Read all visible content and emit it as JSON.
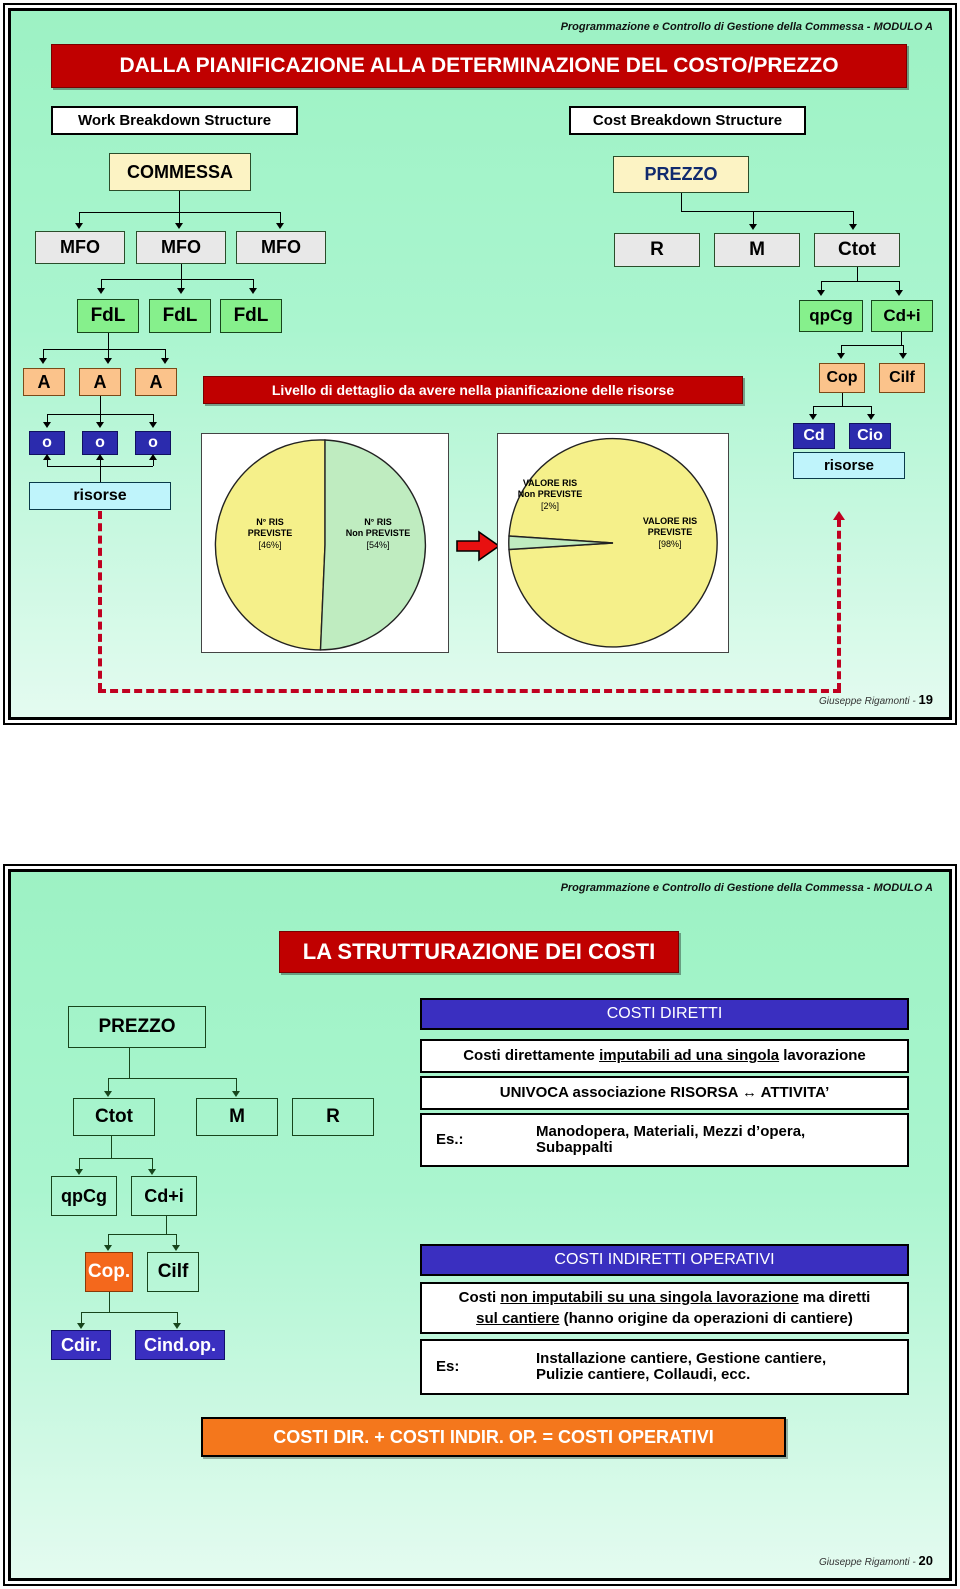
{
  "slide1": {
    "header": "Programmazione e Controllo di Gestione della Commessa - MODULO A",
    "title": "DALLA PIANIFICAZIONE ALLA DETERMINAZIONE DEL COSTO/PREZZO",
    "wbs_label": "Work Breakdown Structure",
    "cbs_label": "Cost Breakdown Structure",
    "banner": "Livello di dettaglio da avere nella pianificazione delle risorse",
    "wbs": {
      "root": "COMMESSA",
      "level2": [
        "MFO",
        "MFO",
        "MFO"
      ],
      "level3": [
        "FdL",
        "FdL",
        "FdL"
      ],
      "level4": [
        "A",
        "A",
        "A"
      ],
      "level5": [
        "o",
        "o",
        "o"
      ],
      "resources": "risorse"
    },
    "cbs": {
      "root": "PREZZO",
      "level2": [
        "R",
        "M",
        "Ctot"
      ],
      "level3": [
        "qpCg",
        "Cd+i"
      ],
      "level4": [
        "Cop",
        "Cilf"
      ],
      "level5": [
        "Cd",
        "Cio"
      ],
      "resources": "risorse"
    },
    "footer_author": "Giuseppe Rigamonti - ",
    "footer_page": "19"
  },
  "chart_data": [
    {
      "type": "pie",
      "title": "N° RIS",
      "labels": [
        "N° RIS PREVISTE",
        "N° RIS Non PREVISTE"
      ],
      "label_lines": [
        [
          "N° RIS",
          "PREVISTE",
          "[46%]"
        ],
        [
          "N° RIS",
          "Non PREVISTE",
          "[54%]"
        ]
      ],
      "values": [
        46,
        54
      ],
      "pct_labels": [
        "[46%]",
        "[54%]"
      ],
      "colors": [
        "#f5f08a",
        "#bfecc0"
      ],
      "legend": "none"
    },
    {
      "type": "pie",
      "title": "VALORE RIS",
      "labels": [
        "VALORE RIS Non PREVISTE",
        "VALORE RIS PREVISTE"
      ],
      "label_lines": [
        [
          "VALORE RIS",
          "Non PREVISTE",
          "[2%]"
        ],
        [
          "VALORE RIS",
          "PREVISTE",
          "[98%]"
        ]
      ],
      "values": [
        2,
        98
      ],
      "pct_labels": [
        "[2%]",
        "[98%]"
      ],
      "colors": [
        "#bfecc0",
        "#f5f08a"
      ],
      "legend": "none"
    }
  ],
  "slide2": {
    "header": "Programmazione e Controllo di Gestione della Commessa - MODULO A",
    "title": "LA STRUTTURAZIONE DEI COSTI",
    "tree": {
      "root": "PREZZO",
      "level2": [
        "Ctot",
        "M",
        "R"
      ],
      "level3": [
        "qpCg",
        "Cd+i"
      ],
      "level4": [
        "Cop.",
        "Cilf"
      ],
      "level5": [
        "Cdir.",
        "Cind.op."
      ]
    },
    "direct": {
      "heading": "COSTI DIRETTI",
      "definition_pre": "Costi direttamente ",
      "definition_underline": "imputabili ad una singola",
      "definition_post": " lavorazione",
      "association": "UNIVOCA associazione RISORSA ↔ ATTIVITA’",
      "example_key": "Es.:",
      "example_lines": [
        "Manodopera, Materiali, Mezzi d’opera,",
        "Subappalti"
      ]
    },
    "indirect": {
      "heading": "COSTI INDIRETTI OPERATIVI",
      "definition_l1_pre": "Costi ",
      "definition_l1_underline": "non imputabili su una singola lavorazione",
      "definition_l1_post": " ma diretti",
      "definition_l2_underline": "sul cantiere",
      "definition_l2_post": " (hanno origine da operazioni di cantiere)",
      "example_key": "Es:",
      "example_lines": [
        "Installazione cantiere, Gestione cantiere,",
        "Pulizie cantiere, Collaudi, ecc."
      ]
    },
    "sum_bar": "COSTI DIR. + COSTI INDIR. OP. = COSTI OPERATIVI",
    "footer_author": "Giuseppe Rigamonti - ",
    "footer_page": "20"
  },
  "colors": {
    "slide_bg": "#9df2c4",
    "title_red": "#c00000",
    "bar_blue": "#3a2fc0",
    "bar_orange": "#f4771c",
    "accent_navy": "#2b2bad",
    "dashed_red": "#c00020",
    "pie_yellow": "#f5f08a",
    "pie_green": "#bfecc0"
  }
}
